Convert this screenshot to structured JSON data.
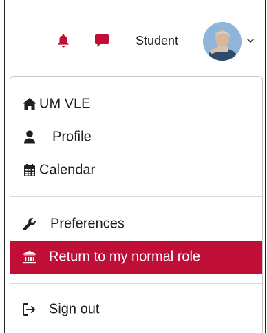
{
  "colors": {
    "accent": "#bf0f37",
    "text": "#1d2125",
    "white": "#ffffff"
  },
  "navbar": {
    "notifications_icon": "bell-icon",
    "messages_icon": "chat-bubble-icon",
    "user_name": "Student",
    "avatar": "user-avatar",
    "menu_toggle_icon": "chevron-down-icon"
  },
  "user_menu": {
    "items": [
      {
        "label": "UM VLE",
        "icon": "home-icon"
      },
      {
        "label": "Profile",
        "icon": "user-icon"
      },
      {
        "label": "Calendar",
        "icon": "calendar-icon"
      },
      {
        "label": "Preferences",
        "icon": "wrench-icon"
      },
      {
        "label": "Return to my normal role",
        "icon": "institution-icon",
        "active": true
      },
      {
        "label": "Sign out",
        "icon": "sign-out-icon"
      }
    ]
  }
}
